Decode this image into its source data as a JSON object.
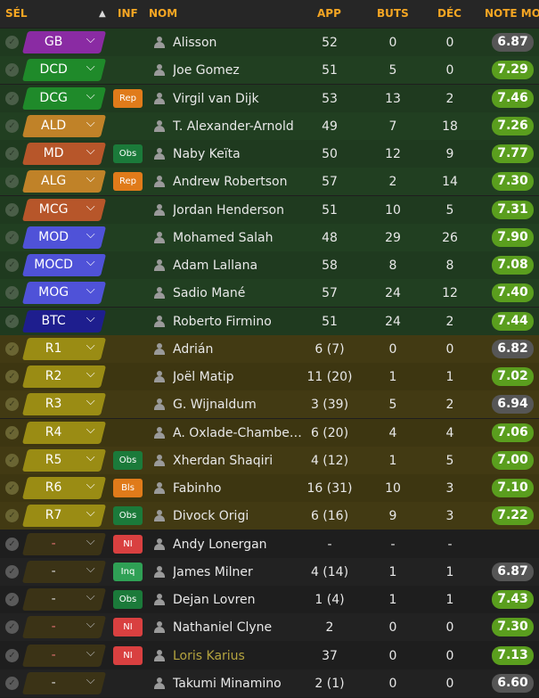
{
  "colors": {
    "header_text": "#f5a623",
    "rating_good": "#5a9e1e",
    "rating_neutral": "#565656",
    "gk": "#8a2ba3",
    "defender": "#1f8a2a",
    "defmid": "#c08228",
    "midfielder": "#b7562a",
    "attmid": "#4f52d8",
    "striker": "#1e1e8e",
    "substitute": "#9a8c14",
    "badge_rep": "#e07b1a",
    "badge_obs": "#1b7a3a",
    "badge_bls": "#e07b1a",
    "badge_ni": "#d94040",
    "badge_inq": "#2fa055"
  },
  "header": {
    "sel": "SÉL",
    "inf": "INF",
    "nom": "NOM",
    "app": "APP",
    "buts": "BUTS",
    "dec": "DÉC",
    "note": "NOTE MOY",
    "sort_icon": "triangle-up-icon"
  },
  "players": [
    {
      "pos": "GB",
      "pos_color": "#8a2ba3",
      "badge": "",
      "name": "Alisson",
      "app": "52",
      "buts": "0",
      "dec": "0",
      "note": "6.87",
      "good": false
    },
    {
      "pos": "DCD",
      "pos_color": "#1f8a2a",
      "badge": "",
      "name": "Joe Gomez",
      "app": "51",
      "buts": "5",
      "dec": "0",
      "note": "7.29",
      "good": true
    },
    {
      "pos": "DCG",
      "pos_color": "#1f8a2a",
      "badge": "Rep",
      "badge_color": "#e07b1a",
      "name": "Virgil van Dijk",
      "app": "53",
      "buts": "13",
      "dec": "2",
      "note": "7.46",
      "good": true
    },
    {
      "pos": "ALD",
      "pos_color": "#c08228",
      "badge": "",
      "name": "T. Alexander-Arnold",
      "app": "49",
      "buts": "7",
      "dec": "18",
      "note": "7.26",
      "good": true
    },
    {
      "pos": "MD",
      "pos_color": "#b7562a",
      "badge": "Obs",
      "badge_color": "#1b7a3a",
      "name": "Naby Keïta",
      "app": "50",
      "buts": "12",
      "dec": "9",
      "note": "7.77",
      "good": true
    },
    {
      "pos": "ALG",
      "pos_color": "#c08228",
      "badge": "Rep",
      "badge_color": "#e07b1a",
      "name": "Andrew Robertson",
      "app": "57",
      "buts": "2",
      "dec": "14",
      "note": "7.30",
      "good": true
    },
    {
      "pos": "MCG",
      "pos_color": "#b7562a",
      "badge": "",
      "name": "Jordan Henderson",
      "app": "51",
      "buts": "10",
      "dec": "5",
      "note": "7.31",
      "good": true
    },
    {
      "pos": "MOD",
      "pos_color": "#4f52d8",
      "badge": "",
      "name": "Mohamed Salah",
      "app": "48",
      "buts": "29",
      "dec": "26",
      "note": "7.90",
      "good": true
    },
    {
      "pos": "MOCD",
      "pos_color": "#4f52d8",
      "badge": "",
      "name": "Adam Lallana",
      "app": "58",
      "buts": "8",
      "dec": "8",
      "note": "7.08",
      "good": true
    },
    {
      "pos": "MOG",
      "pos_color": "#4f52d8",
      "badge": "",
      "name": "Sadio Mané",
      "app": "57",
      "buts": "24",
      "dec": "12",
      "note": "7.40",
      "good": true
    },
    {
      "pos": "BTC",
      "pos_color": "#1e1e8e",
      "badge": "",
      "name": "Roberto Firmino",
      "app": "51",
      "buts": "24",
      "dec": "2",
      "note": "7.44",
      "good": true
    },
    {
      "pos": "R1",
      "pos_color": "#9a8c14",
      "badge": "",
      "name": "Adrián",
      "app": "6 (7)",
      "buts": "0",
      "dec": "0",
      "note": "6.82",
      "good": false
    },
    {
      "pos": "R2",
      "pos_color": "#9a8c14",
      "badge": "",
      "name": "Joël Matip",
      "app": "11 (20)",
      "buts": "1",
      "dec": "1",
      "note": "7.02",
      "good": true
    },
    {
      "pos": "R3",
      "pos_color": "#9a8c14",
      "badge": "",
      "name": "G. Wijnaldum",
      "app": "3 (39)",
      "buts": "5",
      "dec": "2",
      "note": "6.94",
      "good": false
    },
    {
      "pos": "R4",
      "pos_color": "#9a8c14",
      "badge": "",
      "name": "A. Oxlade-Chamberlain",
      "app": "6 (20)",
      "buts": "4",
      "dec": "4",
      "note": "7.06",
      "good": true
    },
    {
      "pos": "R5",
      "pos_color": "#9a8c14",
      "badge": "Obs",
      "badge_color": "#1b7a3a",
      "name": "Xherdan Shaqiri",
      "app": "4 (12)",
      "buts": "1",
      "dec": "5",
      "note": "7.00",
      "good": true
    },
    {
      "pos": "R6",
      "pos_color": "#9a8c14",
      "badge": "Bls",
      "badge_color": "#e07b1a",
      "name": "Fabinho",
      "app": "16 (31)",
      "buts": "10",
      "dec": "3",
      "note": "7.10",
      "good": true
    },
    {
      "pos": "R7",
      "pos_color": "#9a8c14",
      "badge": "Obs",
      "badge_color": "#1b7a3a",
      "name": "Divock Origi",
      "app": "6 (16)",
      "buts": "9",
      "dec": "3",
      "note": "7.22",
      "good": true
    },
    {
      "pos": "-",
      "pos_color": "",
      "pos_text_color": "#e07070",
      "badge": "NI",
      "badge_color": "#d94040",
      "name": "Andy Lonergan",
      "app": "-",
      "buts": "-",
      "dec": "-",
      "note": "",
      "good": false
    },
    {
      "pos": "-",
      "pos_color": "",
      "pos_text_color": "#d8d8d8",
      "badge": "Inq",
      "badge_color": "#2fa055",
      "name": "James Milner",
      "app": "4 (14)",
      "buts": "1",
      "dec": "1",
      "note": "6.87",
      "good": false
    },
    {
      "pos": "-",
      "pos_color": "",
      "pos_text_color": "#d8d8d8",
      "badge": "Obs",
      "badge_color": "#1b7a3a",
      "name": "Dejan Lovren",
      "app": "1 (4)",
      "buts": "1",
      "dec": "1",
      "note": "7.43",
      "good": true
    },
    {
      "pos": "-",
      "pos_color": "",
      "pos_text_color": "#e07070",
      "badge": "NI",
      "badge_color": "#d94040",
      "name": "Nathaniel Clyne",
      "app": "2",
      "buts": "0",
      "dec": "0",
      "note": "7.30",
      "good": true
    },
    {
      "pos": "-",
      "pos_color": "",
      "pos_text_color": "#e07070",
      "badge": "NI",
      "badge_color": "#d94040",
      "name": "Loris Karius",
      "name_gold": true,
      "app": "37",
      "buts": "0",
      "dec": "0",
      "note": "7.13",
      "good": true
    },
    {
      "pos": "-",
      "pos_color": "",
      "pos_text_color": "#d8d8d8",
      "badge": "",
      "name": "Takumi Minamino",
      "app": "2 (1)",
      "buts": "0",
      "dec": "0",
      "note": "6.60",
      "good": false
    }
  ]
}
